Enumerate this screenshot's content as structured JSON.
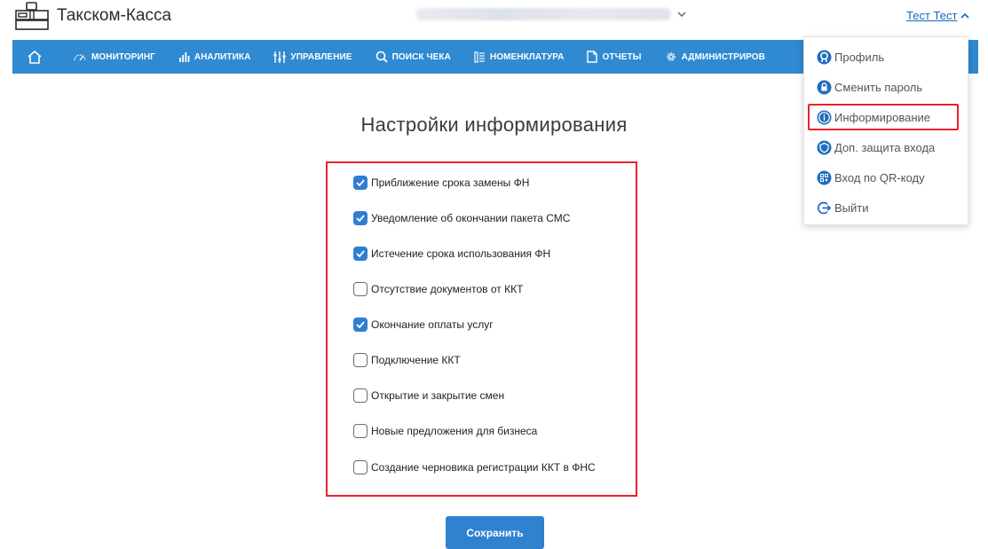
{
  "app": {
    "title": "Такском-Касса"
  },
  "user": {
    "name": "Тест Тест"
  },
  "nav": {
    "items": [
      {
        "label": "МОНИТОРИНГ",
        "icon": "speedometer-icon"
      },
      {
        "label": "АНАЛИТИКА",
        "icon": "bar-chart-icon"
      },
      {
        "label": "УПРАВЛЕНИЕ",
        "icon": "sliders-icon"
      },
      {
        "label": "ПОИСК ЧЕКА",
        "icon": "search-icon"
      },
      {
        "label": "НОМЕНКЛАТУРА",
        "icon": "catalog-icon"
      },
      {
        "label": "ОТЧЕТЫ",
        "icon": "document-icon"
      },
      {
        "label": "АДМИНИСТРИРОВ",
        "icon": "gear-icon"
      }
    ]
  },
  "page": {
    "title": "Настройки информирования"
  },
  "settings": {
    "options": [
      {
        "label": "Приближение срока замены ФН",
        "checked": true
      },
      {
        "label": "Уведомление об окончании пакета СМС",
        "checked": true
      },
      {
        "label": "Истечение срока использования ФН",
        "checked": true
      },
      {
        "label": "Отсутствие документов от ККТ",
        "checked": false
      },
      {
        "label": "Окончание оплаты услуг",
        "checked": true
      },
      {
        "label": "Подключение ККТ",
        "checked": false
      },
      {
        "label": "Открытие и закрытие смен",
        "checked": false
      },
      {
        "label": "Новые предложения для бизнеса",
        "checked": false
      },
      {
        "label": "Создание черновика регистрации ККТ в ФНС",
        "checked": false
      }
    ]
  },
  "save_label": "Сохранить",
  "user_menu": {
    "items": [
      {
        "label": "Профиль",
        "icon": "profile-icon"
      },
      {
        "label": "Сменить пароль",
        "icon": "lock-icon"
      },
      {
        "label": "Информирование",
        "icon": "info-icon",
        "active": true
      },
      {
        "label": "Доп. защита входа",
        "icon": "shield-icon"
      },
      {
        "label": "Вход по QR-коду",
        "icon": "qr-code-icon"
      },
      {
        "label": "Выйти",
        "icon": "logout-icon"
      }
    ]
  },
  "colors": {
    "primary": "#2f8ad2",
    "highlight": "#e8232d",
    "checkbox_checked": "#2e7fd1",
    "link": "#1565c0"
  }
}
